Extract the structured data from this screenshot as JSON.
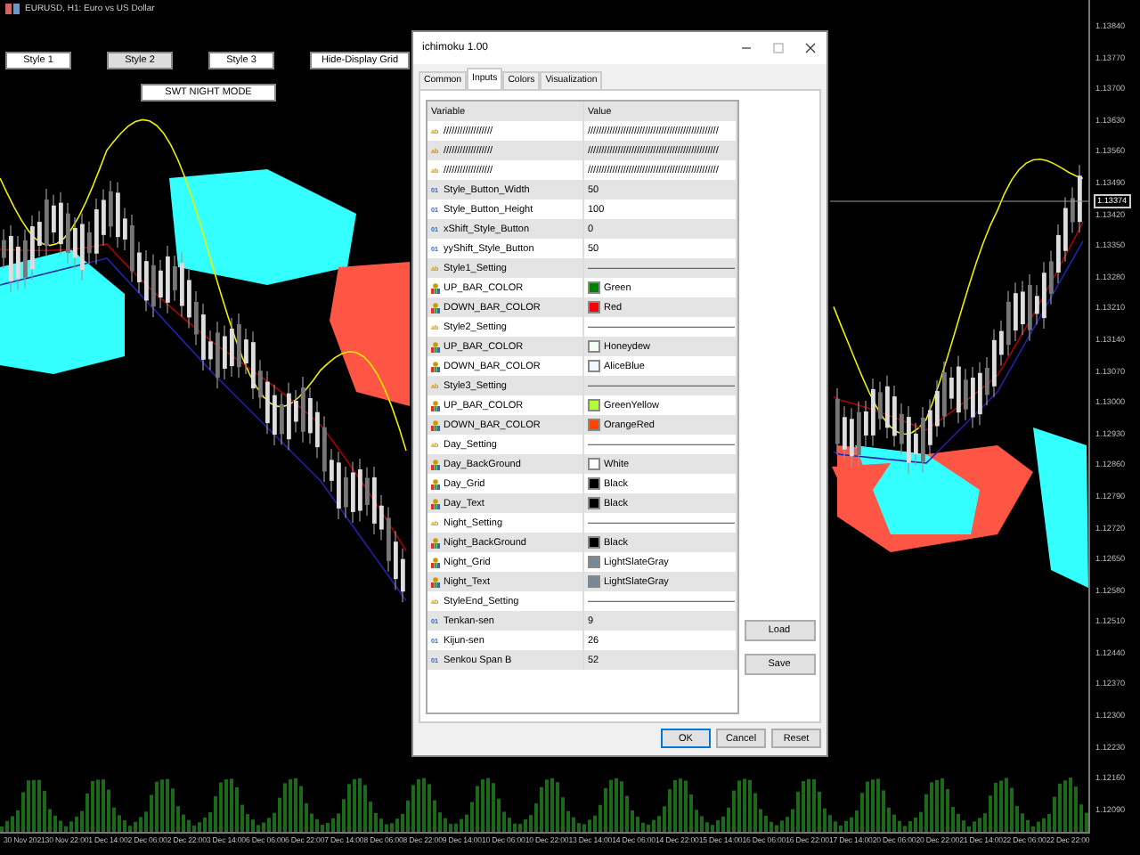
{
  "chart": {
    "title": "EURUSD, H1: Euro vs US Dollar",
    "buttons": [
      {
        "label": "Style 1",
        "selected": false
      },
      {
        "label": "Style 2",
        "selected": true
      },
      {
        "label": "Style 3",
        "selected": false
      },
      {
        "label": "Hide-Display Grid",
        "selected": false
      }
    ],
    "night_button": "SWT NIGHT MODE",
    "price_axis": [
      "1.13840",
      "1.13770",
      "1.13700",
      "1.13630",
      "1.13560",
      "1.13490",
      "1.13420",
      "1.13350",
      "1.13280",
      "1.13210",
      "1.13140",
      "1.13070",
      "1.13000",
      "1.12930",
      "1.12860",
      "1.12790",
      "1.12720",
      "1.12650",
      "1.12580",
      "1.12510",
      "1.12440",
      "1.12370",
      "1.12300",
      "1.12230",
      "1.12160",
      "1.12090"
    ],
    "current_price": "1.13374",
    "time_axis": [
      "30 Nov 2021",
      "30 Nov 22:00",
      "1 Dec 14:00",
      "2 Dec 06:00",
      "2 Dec 22:00",
      "3 Dec 14:00",
      "6 Dec 06:00",
      "6 Dec 22:00",
      "7 Dec 14:00",
      "8 Dec 06:00",
      "8 Dec 22:00",
      "9 Dec 14:00",
      "10 Dec 06:00",
      "10 Dec 22:00",
      "13 Dec 14:00",
      "14 Dec 06:00",
      "14 Dec 22:00",
      "15 Dec 14:00",
      "16 Dec 06:00",
      "16 Dec 22:00",
      "17 Dec 14:00",
      "20 Dec 06:00",
      "20 Dec 22:00",
      "21 Dec 14:00",
      "22 Dec 06:00",
      "22 Dec 22:00"
    ]
  },
  "dialog": {
    "title": "ichimoku 1.00",
    "tabs": [
      {
        "label": "Common",
        "selected": false
      },
      {
        "label": "Inputs",
        "selected": true
      },
      {
        "label": "Colors",
        "selected": false
      },
      {
        "label": "Visualization",
        "selected": false
      }
    ],
    "columns": [
      "Variable",
      "Value"
    ],
    "rows": [
      {
        "kind": "text",
        "badge": "ab",
        "variable": "//////////////////",
        "value": "////////////////////////////////////////////////"
      },
      {
        "kind": "text",
        "badge": "ab",
        "variable": "//////////////////",
        "value": "////////////////////////////////////////////////"
      },
      {
        "kind": "text",
        "badge": "ab",
        "variable": "//////////////////",
        "value": "////////////////////////////////////////////////"
      },
      {
        "kind": "number",
        "badge": "01",
        "variable": "Style_Button_Width",
        "value": "50"
      },
      {
        "kind": "number",
        "badge": "01",
        "variable": "Style_Button_Height",
        "value": "100"
      },
      {
        "kind": "number",
        "badge": "01",
        "variable": "xShift_Style_Button",
        "value": "0"
      },
      {
        "kind": "number",
        "badge": "01",
        "variable": "yyShift_Style_Button",
        "value": "50"
      },
      {
        "kind": "text",
        "badge": "ab",
        "variable": "Style1_Setting",
        "value": "———————————————"
      },
      {
        "kind": "color",
        "variable": "UP_BAR_COLOR",
        "value": "Green",
        "color": "#008000"
      },
      {
        "kind": "color",
        "variable": "DOWN_BAR_COLOR",
        "value": "Red",
        "color": "#ff0000"
      },
      {
        "kind": "text",
        "badge": "ab",
        "variable": "Style2_Setting",
        "value": "———————————————"
      },
      {
        "kind": "color",
        "variable": "UP_BAR_COLOR",
        "value": "Honeydew",
        "color": "#f0fff0"
      },
      {
        "kind": "color",
        "variable": "DOWN_BAR_COLOR",
        "value": "AliceBlue",
        "color": "#f0f8ff"
      },
      {
        "kind": "text",
        "badge": "ab",
        "variable": "Style3_Setting",
        "value": "———————————————"
      },
      {
        "kind": "color",
        "variable": "UP_BAR_COLOR",
        "value": "GreenYellow",
        "color": "#adff2f"
      },
      {
        "kind": "color",
        "variable": "DOWN_BAR_COLOR",
        "value": "OrangeRed",
        "color": "#ff4500"
      },
      {
        "kind": "text",
        "badge": "ab",
        "variable": "Day_Setting",
        "value": "———————————————"
      },
      {
        "kind": "color",
        "variable": "Day_BackGround",
        "value": "White",
        "color": "#ffffff"
      },
      {
        "kind": "color",
        "variable": "Day_Grid",
        "value": "Black",
        "color": "#000000"
      },
      {
        "kind": "color",
        "variable": "Day_Text",
        "value": "Black",
        "color": "#000000"
      },
      {
        "kind": "text",
        "badge": "ab",
        "variable": "Night_Setting",
        "value": "———————————————"
      },
      {
        "kind": "color",
        "variable": "Night_BackGround",
        "value": "Black",
        "color": "#000000"
      },
      {
        "kind": "color",
        "variable": "Night_Grid",
        "value": "LightSlateGray",
        "color": "#778899"
      },
      {
        "kind": "color",
        "variable": "Night_Text",
        "value": "LightSlateGray",
        "color": "#778899"
      },
      {
        "kind": "text",
        "badge": "ab",
        "variable": "StyleEnd_Setting",
        "value": "———————————————"
      },
      {
        "kind": "number",
        "badge": "01",
        "variable": "Tenkan-sen",
        "value": "9"
      },
      {
        "kind": "number",
        "badge": "01",
        "variable": "Kijun-sen",
        "value": "26"
      },
      {
        "kind": "number",
        "badge": "01",
        "variable": "Senkou Span B",
        "value": "52"
      }
    ],
    "side_buttons": [
      "Load",
      "Save"
    ],
    "buttons": [
      "OK",
      "Cancel",
      "Reset"
    ]
  }
}
